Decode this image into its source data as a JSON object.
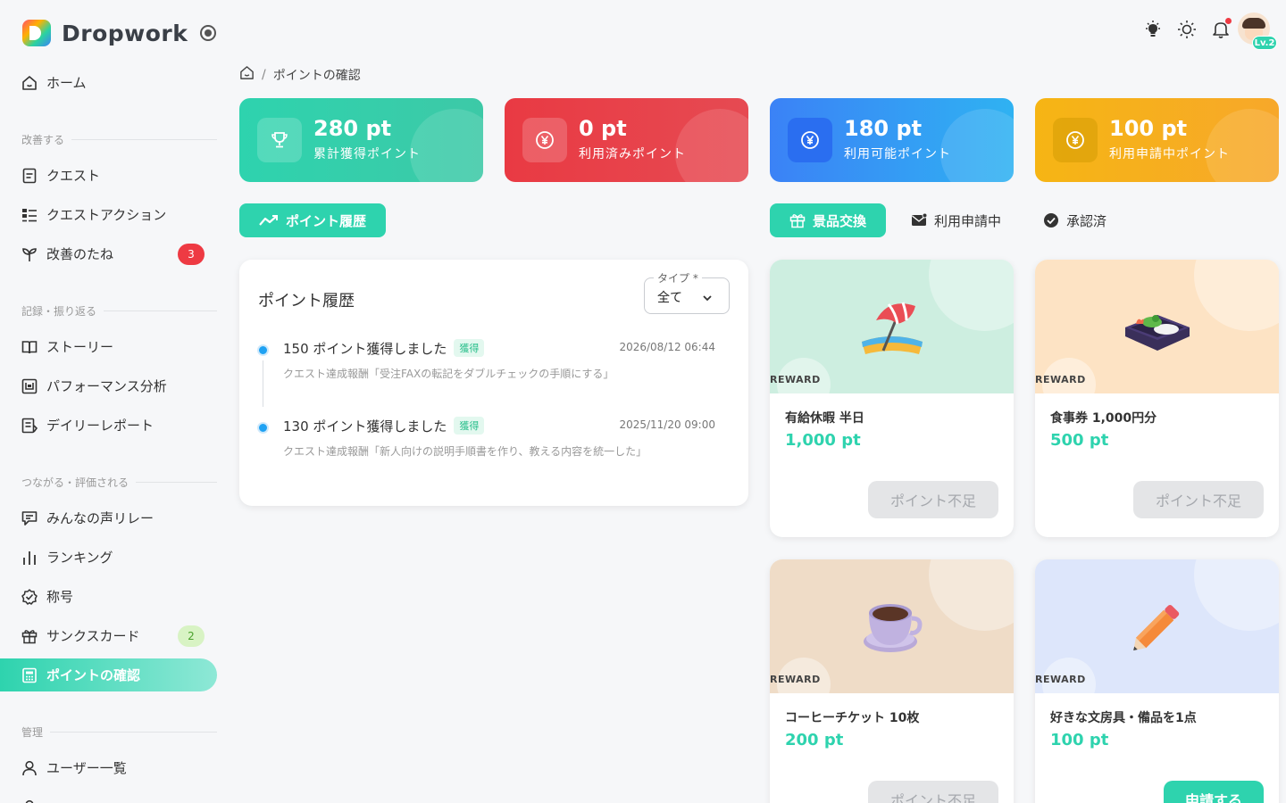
{
  "app": {
    "name": "Dropwork"
  },
  "sidebar": {
    "home": "ホーム",
    "sections": [
      {
        "label": "改善する"
      },
      {
        "label": "記録・振り返る"
      },
      {
        "label": "つながる・評価される"
      },
      {
        "label": "管理"
      }
    ],
    "items": {
      "quest": "クエスト",
      "quest_action": "クエストアクション",
      "improvement_seeds": "改善のたね",
      "improvement_seeds_badge": "3",
      "story": "ストーリー",
      "performance": "パフォーマンス分析",
      "daily_report": "デイリーレポート",
      "voice_relay": "みんなの声リレー",
      "ranking": "ランキング",
      "titles": "称号",
      "thanks_card": "サンクスカード",
      "thanks_card_badge": "2",
      "points": "ポイントの確認",
      "user_list": "ユーザー一覧"
    }
  },
  "header": {
    "level_badge": "Lv.2"
  },
  "breadcrumb": {
    "current": "ポイントの確認"
  },
  "stats": [
    {
      "value": "280 pt",
      "label": "累計獲得ポイント",
      "color": "#2ed3ae",
      "icon": "trophy-icon"
    },
    {
      "value": "0 pt",
      "label": "利用済みポイント",
      "color": "#e93a43",
      "icon": "yen-icon"
    },
    {
      "value": "180 pt",
      "label": "利用可能ポイント",
      "color": "#3b9cf7",
      "icon": "yen-icon"
    },
    {
      "value": "100 pt",
      "label": "利用申請中ポイント",
      "color": "#f6b514",
      "icon": "yen-icon"
    }
  ],
  "tabs": {
    "history": "ポイント履歴",
    "exchange": "景品交換",
    "pending": "利用申請中",
    "approved": "承認済"
  },
  "history": {
    "title": "ポイント履歴",
    "type_label": "タイプ *",
    "type_value": "全て",
    "entries": [
      {
        "title": "150 ポイント獲得しました",
        "tag": "獲得",
        "time": "2026/08/12 06:44",
        "desc": "クエスト達成報酬「受注FAXの転記をダブルチェックの手順にする」"
      },
      {
        "title": "130 ポイント獲得しました",
        "tag": "獲得",
        "time": "2025/11/20 09:00",
        "desc": "クエスト達成報酬「新人向けの説明手順書を作り、教える内容を統一した」"
      }
    ]
  },
  "rewards": [
    {
      "tag": "REWARD",
      "name": "有給休暇 半日",
      "price": "1,000 pt",
      "button": "ポイント不足",
      "bg": "#cdeee0"
    },
    {
      "tag": "REWARD",
      "name": "食事券 1,000円分",
      "price": "500 pt",
      "button": "ポイント不足",
      "bg": "#fde3c4"
    },
    {
      "tag": "REWARD",
      "name": "コーヒーチケット 10枚",
      "price": "200 pt",
      "button": "ポイント不足",
      "bg": "#efdcc7"
    },
    {
      "tag": "REWARD",
      "name": "好きな文房具・備品を1点",
      "price": "100 pt",
      "button": "申請する",
      "bg": "#dde6fb"
    }
  ]
}
